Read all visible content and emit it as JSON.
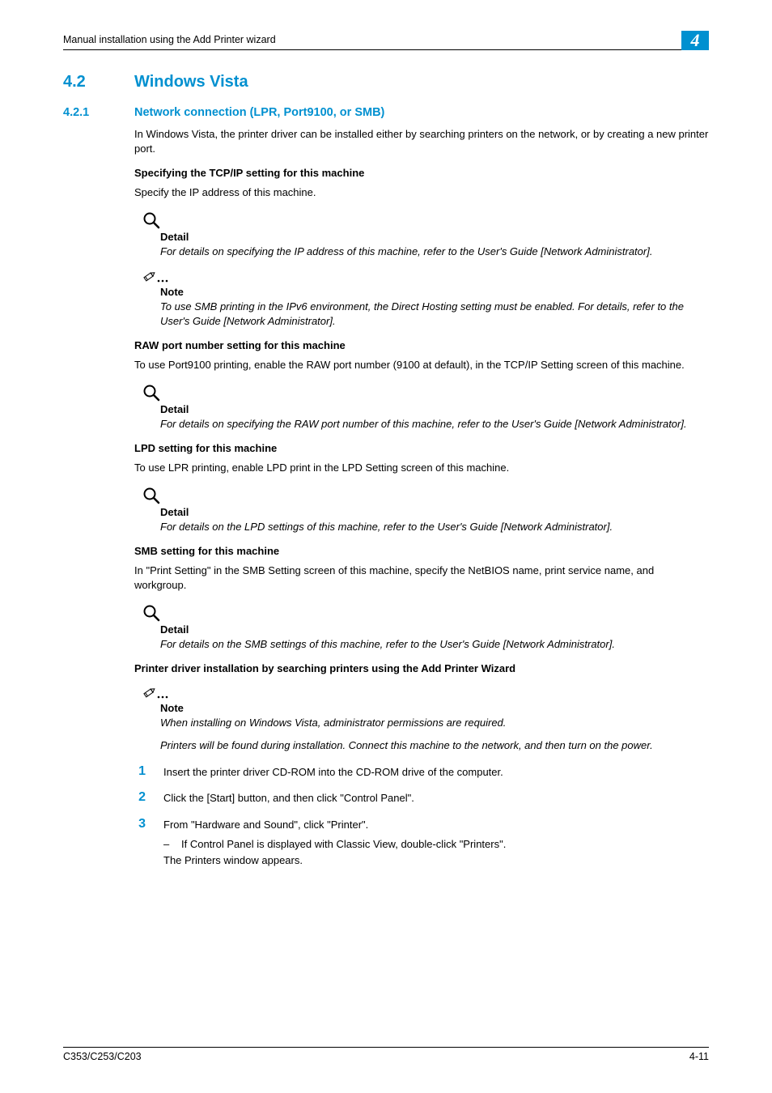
{
  "header": {
    "running_title": "Manual installation using the Add Printer wizard",
    "chapter_badge": "4"
  },
  "section": {
    "num": "4.2",
    "title": "Windows Vista"
  },
  "subsection": {
    "num": "4.2.1",
    "title": "Network connection (LPR, Port9100, or SMB)"
  },
  "intro_para": "In Windows Vista, the printer driver can be installed either by searching printers on the network, or by creating a new printer port.",
  "tcpip": {
    "head": "Specifying the TCP/IP setting for this machine",
    "para": "Specify the IP address of this machine.",
    "detail_label": "Detail",
    "detail_text": "For details on specifying the IP address of this machine, refer to the User's Guide [Network Administrator].",
    "note_label": "Note",
    "note_text": "To use SMB printing in the IPv6 environment, the Direct Hosting setting must be enabled. For details, refer to the User's Guide [Network Administrator]."
  },
  "raw": {
    "head": "RAW port number setting for this machine",
    "para": "To use Port9100 printing, enable the RAW port number (9100 at default), in the TCP/IP Setting screen of this machine.",
    "detail_label": "Detail",
    "detail_text": "For details on specifying the RAW port number of this machine, refer to the User's Guide [Network Administrator]."
  },
  "lpd": {
    "head": "LPD setting for this machine",
    "para": "To use LPR printing, enable LPD print in the LPD Setting screen of this machine.",
    "detail_label": "Detail",
    "detail_text": "For details on the LPD settings of this machine, refer to the User's Guide [Network Administrator]."
  },
  "smb": {
    "head": "SMB setting for this machine",
    "para": "In \"Print Setting\" in the SMB Setting screen of this machine, specify the NetBIOS name, print service name, and workgroup.",
    "detail_label": "Detail",
    "detail_text": "For details on the SMB settings of this machine, refer to the User's Guide [Network Administrator]."
  },
  "install": {
    "head": "Printer driver installation by searching printers using the Add Printer Wizard",
    "note_label": "Note",
    "note_text1": "When installing on Windows Vista, administrator permissions are required.",
    "note_text2": "Printers will be found during installation. Connect this machine to the network, and then turn on the power."
  },
  "steps": [
    {
      "n": "1",
      "text": "Insert the printer driver CD-ROM into the CD-ROM drive of the computer."
    },
    {
      "n": "2",
      "text": "Click the [Start] button, and then click \"Control Panel\"."
    },
    {
      "n": "3",
      "text": "From \"Hardware and Sound\", click \"Printer\".",
      "sub_dash": "–",
      "sub": "If Control Panel is displayed with Classic View, double-click \"Printers\".",
      "after": "The Printers window appears."
    }
  ],
  "footer": {
    "model": "C353/C253/C203",
    "page": "4-11"
  }
}
